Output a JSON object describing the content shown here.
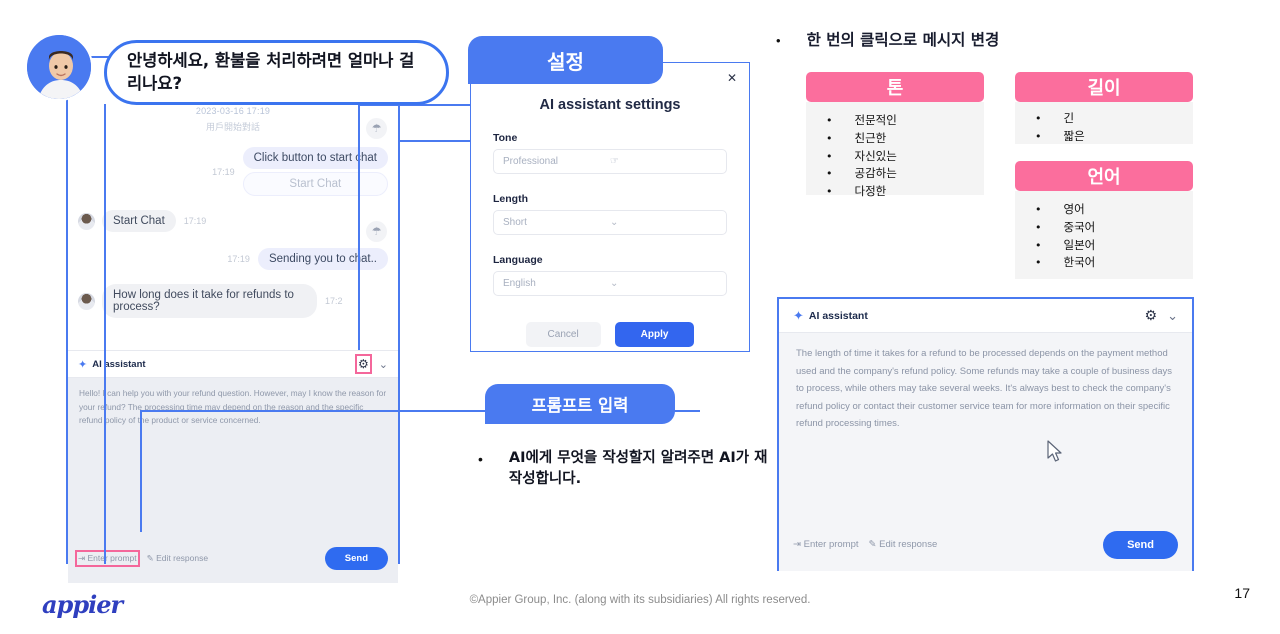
{
  "speech_bubble": {
    "text": "안녕하세요, 환불을 처리하려면 얼마나 걸리나요?"
  },
  "chat": {
    "system_timestamp": "2023-03-16 17:19",
    "system_note": "用戶開始對話",
    "messages": [
      {
        "side": "right",
        "time": "17:19",
        "text": "Click button to start chat",
        "button": "Start Chat"
      },
      {
        "side": "left",
        "time": "17:19",
        "text": "Start Chat"
      },
      {
        "side": "right",
        "time": "17:19",
        "text": "Sending you to chat.."
      },
      {
        "side": "left",
        "time": "17:2",
        "text": "How long does it take for refunds to process?"
      }
    ]
  },
  "ai_panel_left": {
    "title": "AI assistant",
    "spark_icon": "sparkle-icon",
    "gear_icon": "gear-icon",
    "chevron_icon": "chevron-down-icon",
    "response": "Hello! I can help you with your refund question. However, may I know the reason for your refund? The processing time may depend on the reason and the specific refund policy of the product or service concerned.",
    "enter_prompt": "Enter prompt",
    "edit_response": "Edit response",
    "send": "Send"
  },
  "settings_callout": {
    "label": "설정"
  },
  "settings_dialog": {
    "close_icon": "close-icon",
    "title": "AI assistant settings",
    "fields": [
      {
        "label": "Tone",
        "value": "Professional",
        "caret": "hand-cursor"
      },
      {
        "label": "Length",
        "value": "Short",
        "caret": "⌄"
      },
      {
        "label": "Language",
        "value": "English",
        "caret": "⌄"
      }
    ],
    "cancel": "Cancel",
    "apply": "Apply"
  },
  "prompt_callout": {
    "label": "프롬프트 입력"
  },
  "prompt_bullet": {
    "text": "AI에게 무엇을 작성할지 알려주면 AI가 재작성합니다."
  },
  "right_heading": {
    "text": "한 번의 클릭으로 메시지 변경"
  },
  "option_cards": [
    {
      "title": "톤",
      "items": [
        "전문적인",
        "친근한",
        "자신있는",
        "공감하는",
        "다정한"
      ]
    },
    {
      "title": "길이",
      "items": [
        "긴",
        "짧은"
      ]
    },
    {
      "title": "언어",
      "items": [
        "영어",
        "중국어",
        "일본어",
        "한국어"
      ]
    }
  ],
  "ai_panel_right": {
    "title": "AI assistant",
    "response": "The length of time it takes for a refund to be processed depends on the payment method used and the company's refund policy. Some refunds may take a couple of business days to process, while others may take several weeks. It's always best to check the company's refund policy or contact their customer service team for more information on their specific refund processing times.",
    "enter_prompt": "Enter prompt",
    "edit_response": "Edit response",
    "send": "Send"
  },
  "footer": {
    "logo": "appier",
    "copyright": "©Appier Group, Inc. (along with its subsidiaries) All rights reserved.",
    "page_number": "17"
  },
  "colors": {
    "accent_blue": "#4a7af0",
    "accent_pink": "#fb6e9d",
    "send_blue": "#2f6bf0",
    "highlight_pink": "#f4679b"
  }
}
